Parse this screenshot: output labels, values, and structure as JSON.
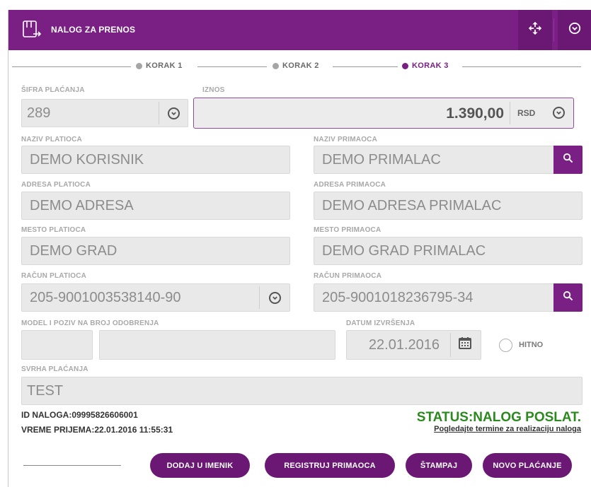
{
  "header": {
    "title": "NALOG ZA PRENOS",
    "icons": {
      "document": "document-transfer-icon",
      "move": "move-arrows-icon",
      "collapse": "chevron-down-circle-icon"
    },
    "accent_color": "#7a1f84"
  },
  "steps": [
    {
      "label": "KORAK 1",
      "active": false
    },
    {
      "label": "KORAK 2",
      "active": false
    },
    {
      "label": "KORAK 3",
      "active": true
    }
  ],
  "form": {
    "sifra_placanja": {
      "label": "ŠIFRA PLAĆANJA",
      "value": "289"
    },
    "iznos": {
      "label": "IZNOS",
      "value": "1.390,00",
      "currency": "RSD"
    },
    "naziv_platioca": {
      "label": "NAZIV PLATIOCA",
      "value": "DEMO KORISNIK"
    },
    "naziv_primaoca": {
      "label": "NAZIV PRIMAOCA",
      "value": "DEMO PRIMALAC"
    },
    "adresa_platioca": {
      "label": "ADRESA PLATIOCA",
      "value": "DEMO ADRESA"
    },
    "adresa_primaoca": {
      "label": "ADRESA PRIMAOCA",
      "value": "DEMO ADRESA PRIMALAC"
    },
    "mesto_platioca": {
      "label": "MESTO PLATIOCA",
      "value": "DEMO GRAD"
    },
    "mesto_primaoca": {
      "label": "MESTO PRIMAOCA",
      "value": "DEMO GRAD PRIMALAC"
    },
    "racun_platioca": {
      "label": "RAČUN PLATIOCA",
      "value": "205-9001003538140-90"
    },
    "racun_primaoca": {
      "label": "RAČUN PRIMAOCA",
      "value": "205-9001018236795-34"
    },
    "model_poziv": {
      "label": "MODEL I POZIV NA BROJ ODOBRENJA",
      "model": "",
      "poziv": ""
    },
    "datum_izvrsenja": {
      "label": "DATUM IZVRŠENJA",
      "value": "22.01.2016"
    },
    "hitno": {
      "label": "HITNO",
      "checked": false
    },
    "svrha_placanja": {
      "label": "SVRHA PLAĆANJA",
      "value": "TEST"
    }
  },
  "info": {
    "id_naloga": "ID NALOGA:09995826606001",
    "vreme_prijema": "VREME PRIJEMA:22.01.2016 11:55:31",
    "status": "STATUS:NALOG POSLAT.",
    "status_color": "#2b8a1e",
    "termini_link": "Pogledajte termine za realizaciju naloga"
  },
  "buttons": {
    "dodaj_u_imenik": "DODAJ U IMENIK",
    "registruj_primaoca": "REGISTRUJ PRIMAOCA",
    "stampaj": "ŠTAMPAJ",
    "novo_placanje": "NOVO PLAĆANJE"
  }
}
